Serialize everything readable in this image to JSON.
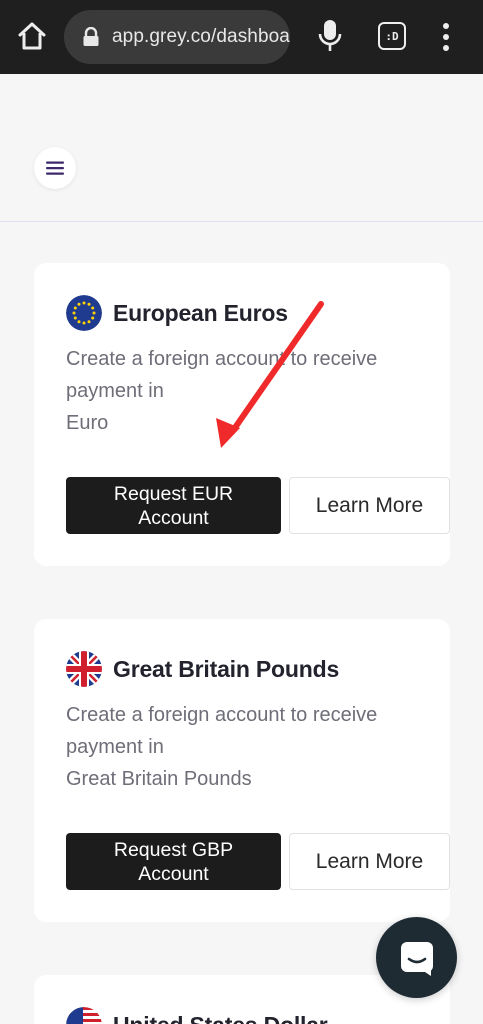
{
  "browser": {
    "url": "app.grey.co/dashboa",
    "tab_label": ":D"
  },
  "cards": [
    {
      "title": "European Euros",
      "desc_lines": [
        "Create a foreign account to receive",
        "payment in",
        "Euro"
      ],
      "request_lines": [
        "Request EUR",
        "Account"
      ],
      "learn_label": "Learn More",
      "flag_icon": "eu-flag-icon"
    },
    {
      "title": "Great Britain Pounds",
      "desc_lines": [
        "Create a foreign account to receive",
        "payment in",
        "Great Britain Pounds"
      ],
      "request_lines": [
        "Request GBP",
        "Account"
      ],
      "learn_label": "Learn More",
      "flag_icon": "uk-flag-icon"
    },
    {
      "title": "United States Dollar",
      "flag_icon": "us-flag-icon"
    }
  ],
  "colors": {
    "accent_menu": "#3b2a6b",
    "button_dark": "#1c1c1c",
    "annotation_arrow": "#f02a2a",
    "chat_bg": "#1f2b33"
  }
}
